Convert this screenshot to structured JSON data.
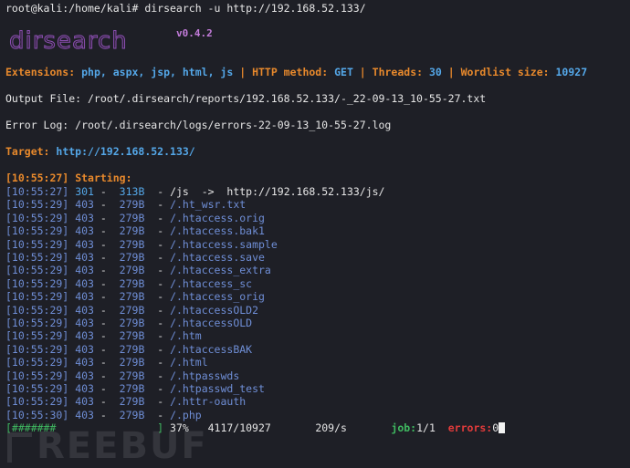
{
  "prompt": "root@kali:/home/kali# dirsearch -u http://192.168.52.133/",
  "logo": "dirsearch",
  "version": "v0.4.2",
  "summary": {
    "ext_label": "Extensions:",
    "ext_value": "php, aspx, jsp, html, js",
    "method_label": "HTTP method:",
    "method_value": "GET",
    "threads_label": "Threads:",
    "threads_value": "30",
    "wordlist_label": "Wordlist size:",
    "wordlist_value": "10927",
    "sep": " | "
  },
  "output_file": "Output File: /root/.dirsearch/reports/192.168.52.133/-_22-09-13_10-55-27.txt",
  "error_log": "Error Log: /root/.dirsearch/logs/errors-22-09-13_10-55-27.log",
  "target_label": "Target:",
  "target_value": "http://192.168.52.133/",
  "starting_time": "[10:55:27]",
  "starting_label": "Starting:",
  "entries": [
    {
      "time": "[10:55:27]",
      "code": "301",
      "size": "313B",
      "path": "/js  ->  http://192.168.52.133/js/"
    },
    {
      "time": "[10:55:29]",
      "code": "403",
      "size": "279B",
      "path": "/.ht_wsr.txt"
    },
    {
      "time": "[10:55:29]",
      "code": "403",
      "size": "279B",
      "path": "/.htaccess.orig"
    },
    {
      "time": "[10:55:29]",
      "code": "403",
      "size": "279B",
      "path": "/.htaccess.bak1"
    },
    {
      "time": "[10:55:29]",
      "code": "403",
      "size": "279B",
      "path": "/.htaccess.sample"
    },
    {
      "time": "[10:55:29]",
      "code": "403",
      "size": "279B",
      "path": "/.htaccess.save"
    },
    {
      "time": "[10:55:29]",
      "code": "403",
      "size": "279B",
      "path": "/.htaccess_extra"
    },
    {
      "time": "[10:55:29]",
      "code": "403",
      "size": "279B",
      "path": "/.htaccess_sc"
    },
    {
      "time": "[10:55:29]",
      "code": "403",
      "size": "279B",
      "path": "/.htaccess_orig"
    },
    {
      "time": "[10:55:29]",
      "code": "403",
      "size": "279B",
      "path": "/.htaccessOLD2"
    },
    {
      "time": "[10:55:29]",
      "code": "403",
      "size": "279B",
      "path": "/.htaccessOLD"
    },
    {
      "time": "[10:55:29]",
      "code": "403",
      "size": "279B",
      "path": "/.htm"
    },
    {
      "time": "[10:55:29]",
      "code": "403",
      "size": "279B",
      "path": "/.htaccessBAK"
    },
    {
      "time": "[10:55:29]",
      "code": "403",
      "size": "279B",
      "path": "/.html"
    },
    {
      "time": "[10:55:29]",
      "code": "403",
      "size": "279B",
      "path": "/.htpasswds"
    },
    {
      "time": "[10:55:29]",
      "code": "403",
      "size": "279B",
      "path": "/.htpasswd_test"
    },
    {
      "time": "[10:55:29]",
      "code": "403",
      "size": "279B",
      "path": "/.httr-oauth"
    },
    {
      "time": "[10:55:30]",
      "code": "403",
      "size": "279B",
      "path": "/.php"
    }
  ],
  "progress": {
    "bar": "[#######                ]",
    "percent": "37%",
    "count": "4117/10927",
    "rate": "209/s",
    "job_label": "job:",
    "job_value": "1/1",
    "errors_label": "errors:",
    "errors_value": "0"
  },
  "watermark": "REEBUF",
  "colors": {
    "background": "#1e1f26",
    "orange": "#e8892c",
    "blue": "#54a7e8",
    "time_blue": "#6f8ed6",
    "red": "#e23b3b",
    "green": "#3fb860"
  }
}
